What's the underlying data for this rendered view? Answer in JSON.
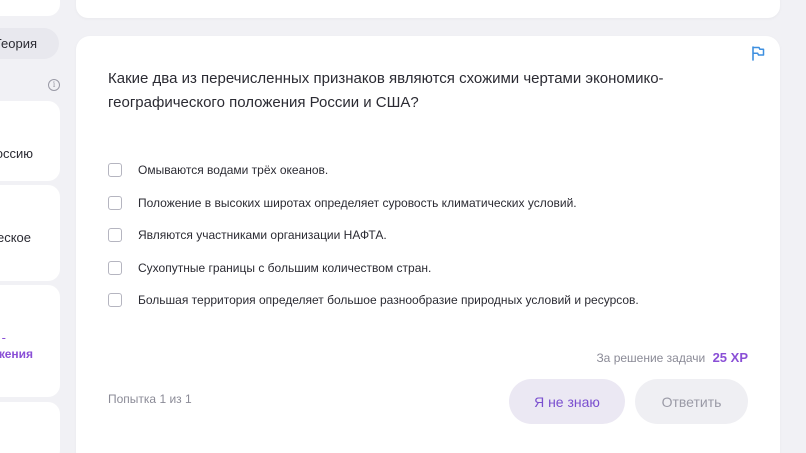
{
  "sidebar": {
    "theory_label": "Теория",
    "info_glyph": "i",
    "items": [
      {
        "label": "оссию"
      },
      {
        "label": "еское"
      },
      {
        "label_line1": "-",
        "label_line2": "жения"
      }
    ]
  },
  "task": {
    "question": "Какие два из перечисленных признаков являются схожими чертами экономико-географического положения России и США?",
    "options": [
      "Омываются водами трёх океанов.",
      "Положение в высоких широтах определяет суровость климатических условий.",
      "Являются участниками организации НАФТА.",
      "Сухопутные границы с большим количеством стран.",
      "Большая территория определяет большое разнообразие природных условий и ресурсов."
    ],
    "reward_label": "За решение задачи",
    "reward_value": "25 XP",
    "attempt_text": "Попытка 1 из 1",
    "dont_know_label": "Я не знаю",
    "answer_label": "Ответить"
  },
  "colors": {
    "accent": "#8a4fd6",
    "flag": "#3d8fe0",
    "background": "#f1f1f5"
  },
  "icons": {
    "flag": "flag-icon",
    "info": "info-icon"
  }
}
